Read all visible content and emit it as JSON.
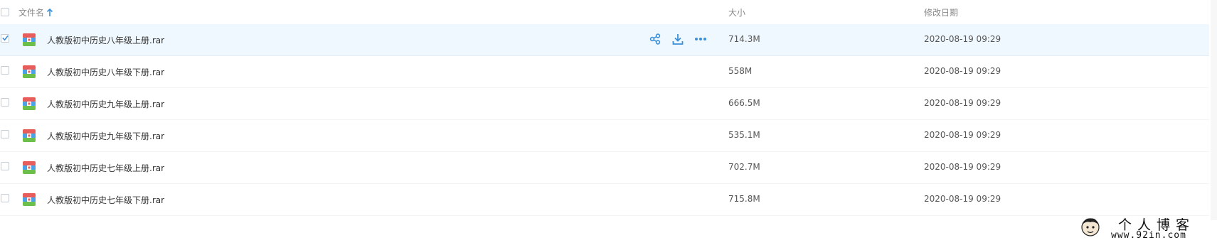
{
  "header": {
    "name_label": "文件名",
    "size_label": "大小",
    "date_label": "修改日期"
  },
  "files": [
    {
      "name": "人教版初中历史八年级上册.rar",
      "size": "714.3M",
      "date": "2020-08-19 09:29",
      "selected": true
    },
    {
      "name": "人教版初中历史八年级下册.rar",
      "size": "558M",
      "date": "2020-08-19 09:29",
      "selected": false
    },
    {
      "name": "人教版初中历史九年级上册.rar",
      "size": "666.5M",
      "date": "2020-08-19 09:29",
      "selected": false
    },
    {
      "name": "人教版初中历史九年级下册.rar",
      "size": "535.1M",
      "date": "2020-08-19 09:29",
      "selected": false
    },
    {
      "name": "人教版初中历史七年级上册.rar",
      "size": "702.7M",
      "date": "2020-08-19 09:29",
      "selected": false
    },
    {
      "name": "人教版初中历史七年级下册.rar",
      "size": "715.8M",
      "date": "2020-08-19 09:29",
      "selected": false
    }
  ],
  "icons": {
    "sort": "arrow-up-icon",
    "file": "rar-archive-icon",
    "share": "share-icon",
    "download": "download-icon",
    "more": "more-dots-icon"
  },
  "colors": {
    "accent": "#3b8fd9",
    "selected_row": "#f0f8ff"
  },
  "watermark": {
    "title": "个人博客",
    "url": "www.92in.com"
  }
}
